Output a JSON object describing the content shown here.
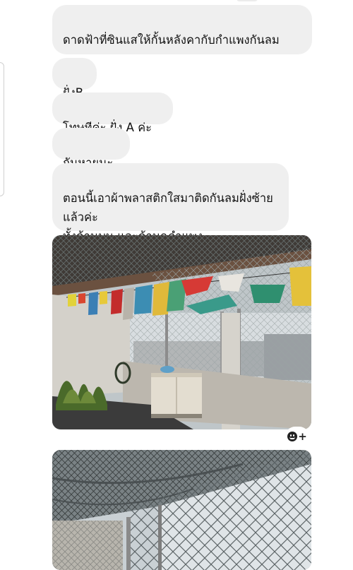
{
  "conversation": {
    "messages": [
      {
        "text": "ดาดฟ้าที่ซินแสให้กั้นหลังคากับกำแพงกันลม"
      },
      {
        "text": "ฝั่งB"
      },
      {
        "text": "โทษทีค่ะ ฝั่ง A ค่ะ"
      },
      {
        "text": "กันหายนะ"
      },
      {
        "text": "ตอนนี้เอาผ้าพลาสติกใสมาติดกันลมฝั่งซ้ายแล้วค่ะ\nทั้งด้านบน และด้านกฎำแพง"
      }
    ],
    "photos": [
      {
        "icon": "rooftop-photo-with-flags"
      },
      {
        "icon": "rooftop-net-photo"
      }
    ],
    "reaction_button": {
      "icon": "add-reaction-icon",
      "plus": "+"
    }
  }
}
